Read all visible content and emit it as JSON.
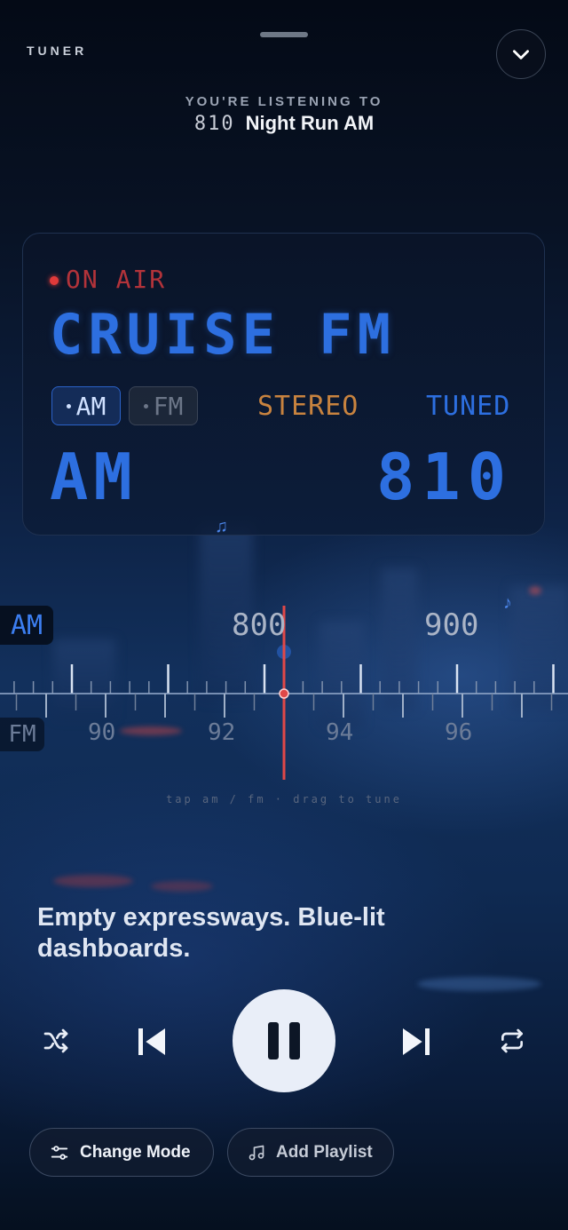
{
  "header": {
    "tuner_label": "TUNER",
    "listening_label": "YOU'RE LISTENING TO",
    "now_playing_freq": "810",
    "now_playing_name": "Night Run AM"
  },
  "display": {
    "on_air": "ON AIR",
    "station_name": "CRUISE FM",
    "band_buttons": [
      {
        "label": "AM",
        "active": true
      },
      {
        "label": "FM",
        "active": false
      }
    ],
    "stereo": "STEREO",
    "tuned": "TUNED",
    "band": "AM",
    "frequency": "810"
  },
  "dial": {
    "am_label": "AM",
    "fm_label": "FM",
    "am_marks": [
      "800",
      "900"
    ],
    "fm_marks": [
      "90",
      "92",
      "94",
      "96"
    ],
    "hint": "tap am / fm · drag to tune"
  },
  "tagline": "Empty expressways. Blue-lit dashboards.",
  "actions": {
    "change_mode": "Change Mode",
    "add_playlist": "Add Playlist"
  },
  "colors": {
    "accent_blue": "#2d6fe0",
    "on_air_red": "#b2333a",
    "stereo_orange": "#c8833f",
    "needle_red": "#e04848"
  },
  "icons": [
    "chevron-down-icon",
    "music-note-icon",
    "shuffle-icon",
    "previous-icon",
    "pause-icon",
    "next-icon",
    "repeat-icon",
    "sliders-icon"
  ]
}
